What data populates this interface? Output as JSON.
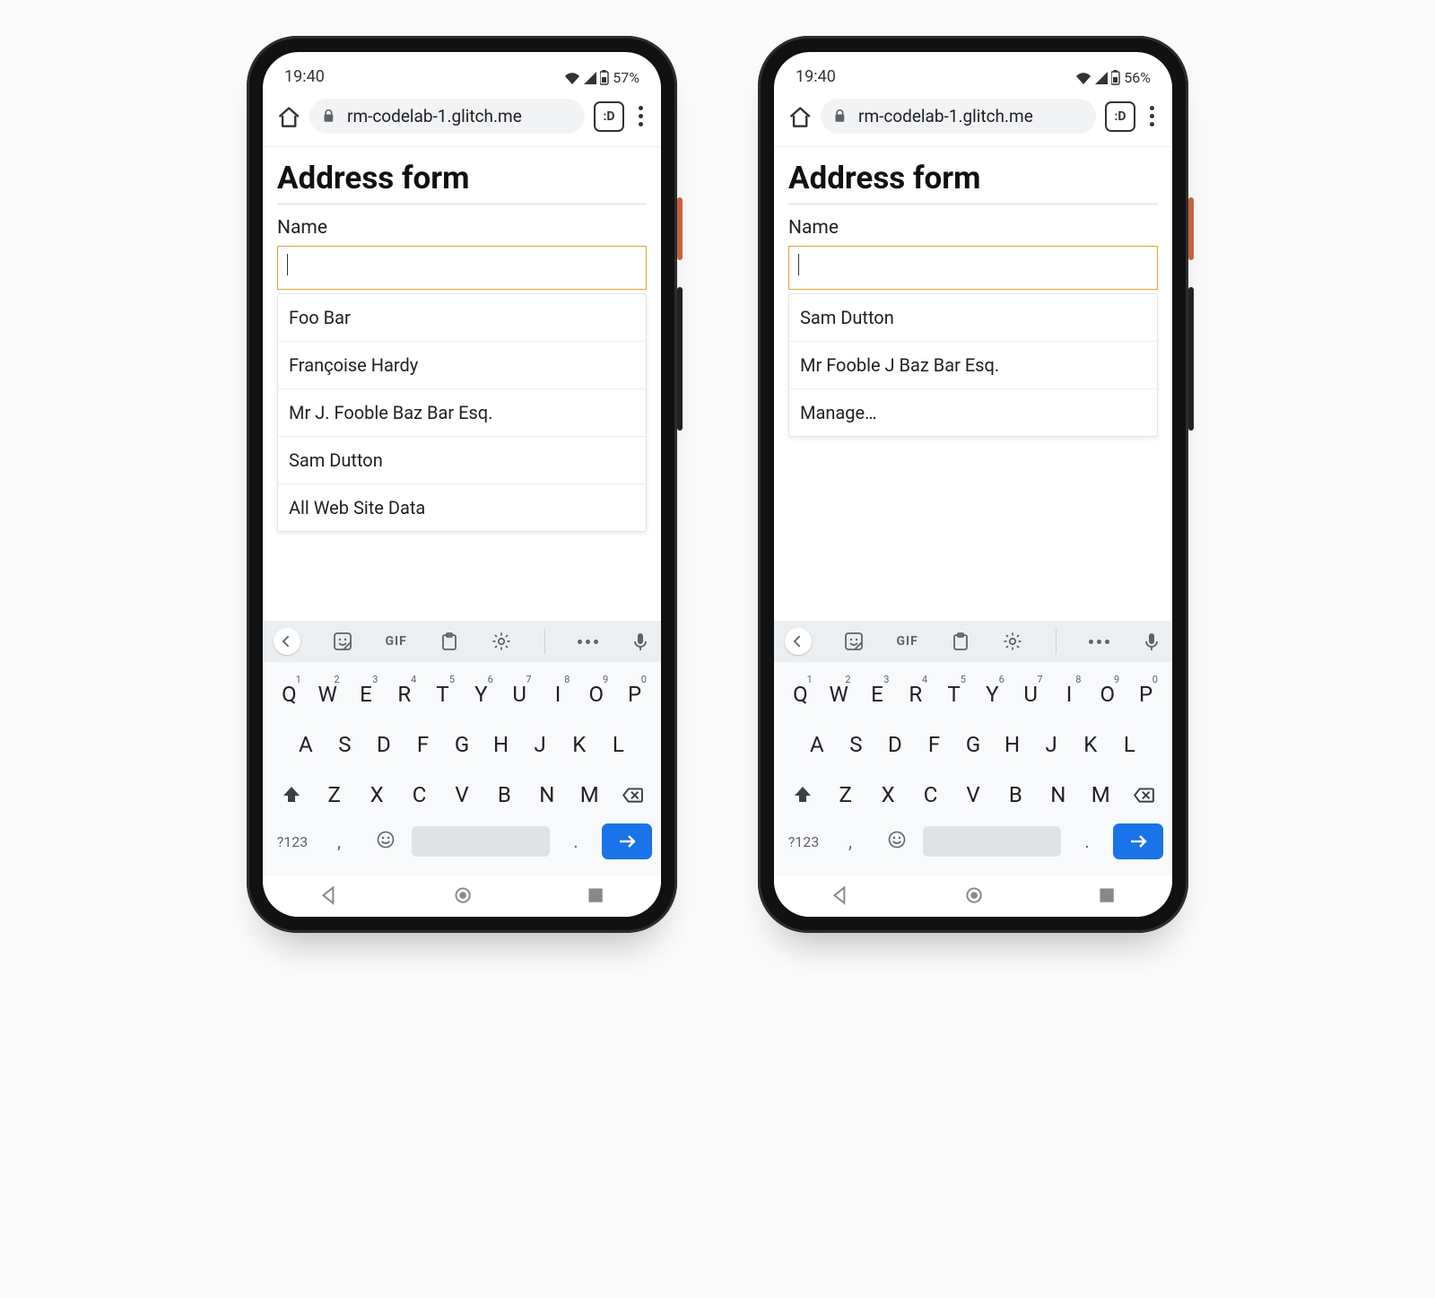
{
  "phones": [
    {
      "status": {
        "time": "19:40",
        "battery": "57%"
      },
      "browser": {
        "url": "rm-codelab-1.glitch.me",
        "reader_label": ":D"
      },
      "page": {
        "heading": "Address form",
        "name_label": "Name",
        "name_value": ""
      },
      "suggestions": [
        "Foo Bar",
        "Françoise Hardy",
        "Mr J. Fooble Baz Bar Esq.",
        "Sam Dutton",
        "All Web Site Data"
      ]
    },
    {
      "status": {
        "time": "19:40",
        "battery": "56%"
      },
      "browser": {
        "url": "rm-codelab-1.glitch.me",
        "reader_label": ":D"
      },
      "page": {
        "heading": "Address form",
        "name_label": "Name",
        "name_value": ""
      },
      "suggestions": [
        "Sam Dutton",
        "Mr Fooble J Baz Bar Esq.",
        "Manage…"
      ]
    }
  ],
  "keyboard": {
    "tools_gif": "GIF",
    "row1": [
      {
        "k": "Q",
        "s": "1"
      },
      {
        "k": "W",
        "s": "2"
      },
      {
        "k": "E",
        "s": "3"
      },
      {
        "k": "R",
        "s": "4"
      },
      {
        "k": "T",
        "s": "5"
      },
      {
        "k": "Y",
        "s": "6"
      },
      {
        "k": "U",
        "s": "7"
      },
      {
        "k": "I",
        "s": "8"
      },
      {
        "k": "O",
        "s": "9"
      },
      {
        "k": "P",
        "s": "0"
      }
    ],
    "row2": [
      "A",
      "S",
      "D",
      "F",
      "G",
      "H",
      "J",
      "K",
      "L"
    ],
    "row3": [
      "Z",
      "X",
      "C",
      "V",
      "B",
      "N",
      "M"
    ],
    "sym_label": "?123",
    "comma": ",",
    "period": "."
  }
}
